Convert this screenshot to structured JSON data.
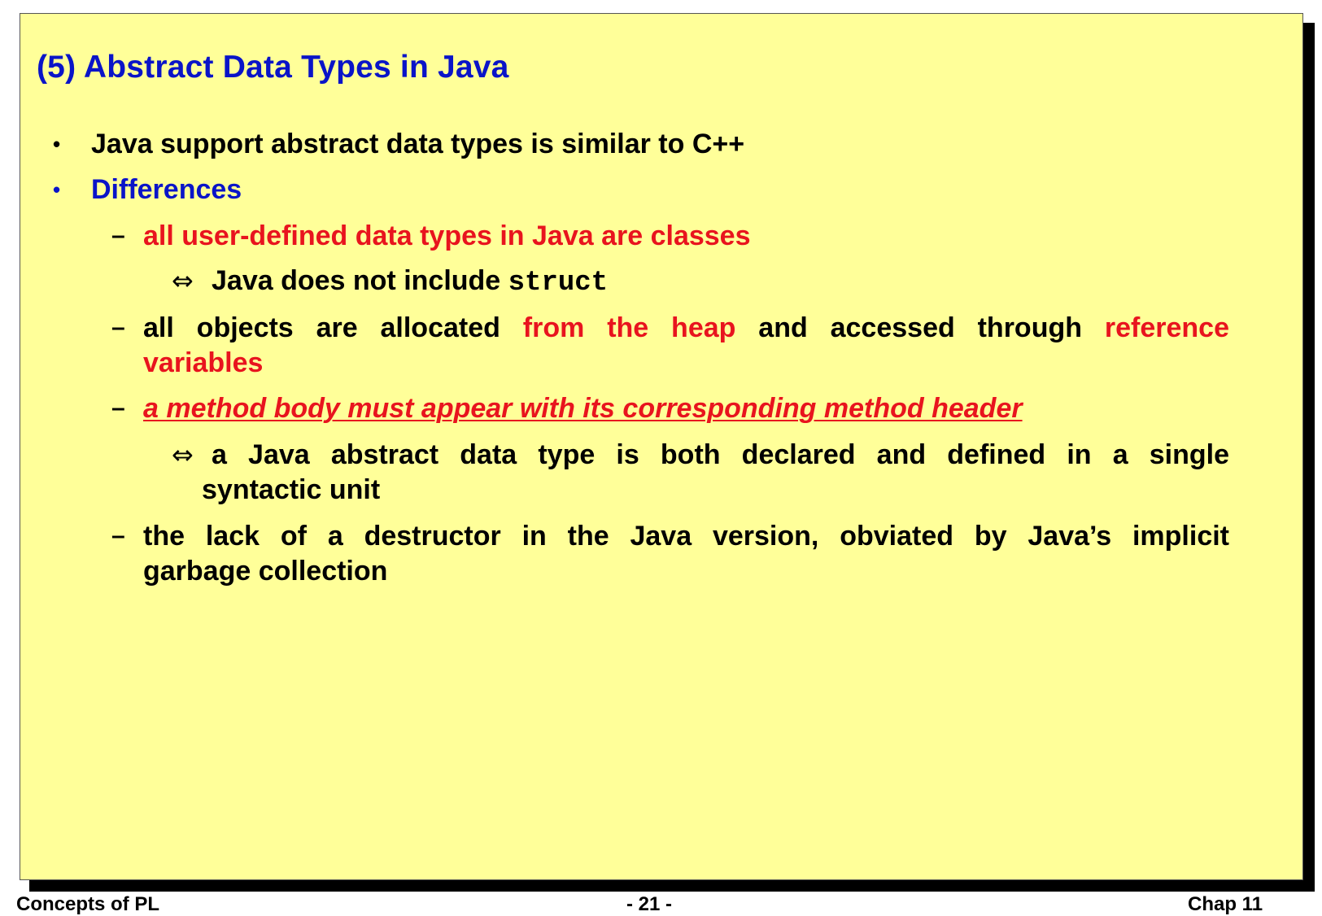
{
  "slide": {
    "title": "(5) Abstract Data Types in Java",
    "bullets": [
      {
        "text": "Java support abstract data types is similar to C++"
      },
      {
        "text": "Differences"
      }
    ],
    "items": {
      "item1": "all user-defined data types in Java are classes",
      "item1_sub_text": "Java does not include ",
      "item1_sub_code": "struct",
      "item2_a": "all objects are allocated ",
      "item2_b": "from the heap",
      "item2_c": " and accessed through ",
      "item2_d": "reference",
      "item2_e": "variables",
      "item3": "a method body must appear with its corresponding method header",
      "item3_sub_line1": "a Java abstract data type is both declared and defined in a single",
      "item3_sub_line2": "syntactic unit",
      "item4_line1": "the lack of a destructor in the Java version, obviated by Java’s implicit",
      "item4_line2": "garbage collection"
    },
    "symbols": {
      "bullet": "•",
      "dash": "–",
      "equiv_arrow": "⇔"
    }
  },
  "footer": {
    "left": "Concepts of PL",
    "center": "- 21 -",
    "right": "Chap 11"
  },
  "colors": {
    "background": "#ffff99",
    "title": "#0a14c8",
    "emphasis_red": "#e8141e",
    "text": "#000000"
  }
}
